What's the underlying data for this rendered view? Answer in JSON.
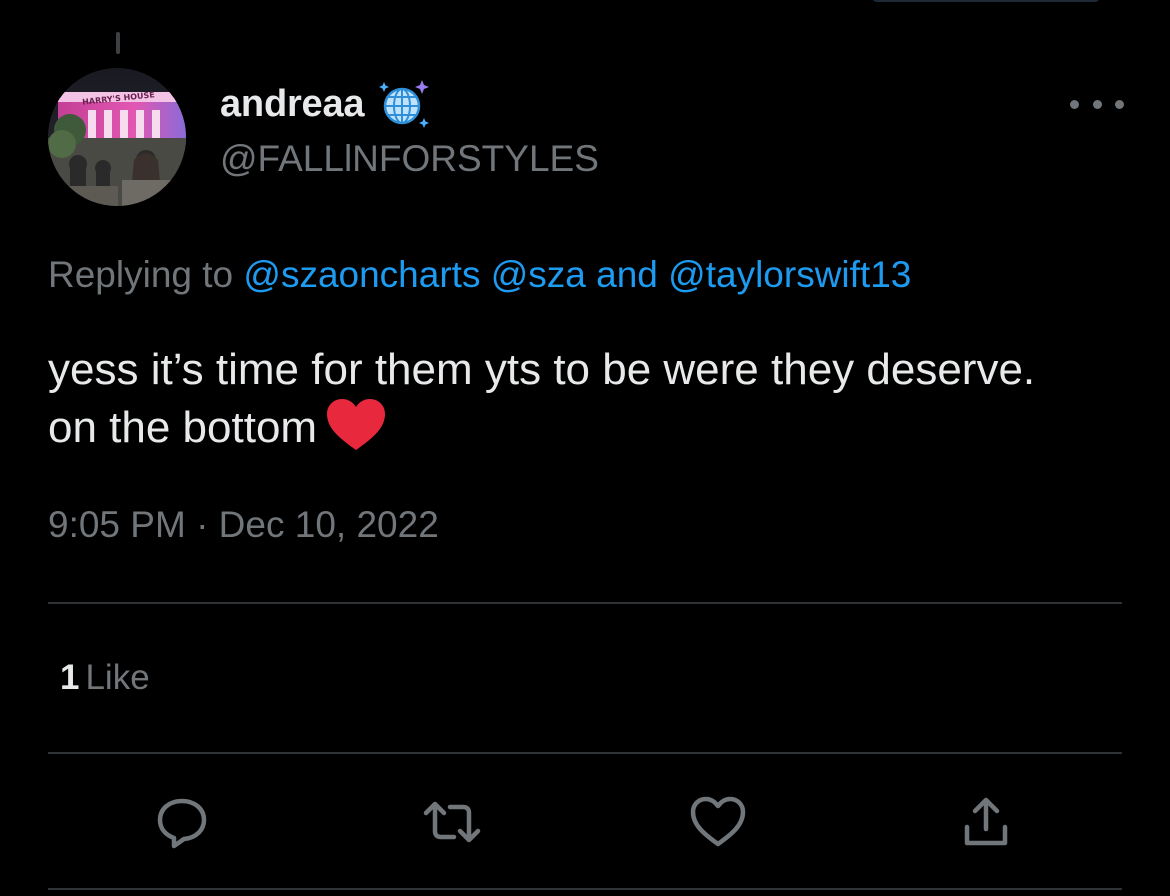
{
  "tweet": {
    "display_name": "andreaa",
    "display_name_emoji": "mirror-ball-icon",
    "handle": "@FALLlNFORSTYLES",
    "replying_prefix": "Replying to",
    "mentions": [
      "@szaoncharts",
      "@sza",
      "@taylorswift13"
    ],
    "replying_joiner": "and",
    "text": "yess it’s time for them yts to be were they deserve. on the bottom",
    "text_emoji": "red-heart-icon",
    "timestamp": "9:05 PM · Dec 10, 2022",
    "likes_count": "1",
    "likes_label": "Like",
    "avatar_sign_text": "HARRY'S HOUSE"
  },
  "actions": [
    {
      "name": "reply",
      "icon": "reply-icon"
    },
    {
      "name": "retweet",
      "icon": "retweet-icon"
    },
    {
      "name": "like",
      "icon": "heart-outline-icon"
    },
    {
      "name": "share",
      "icon": "share-icon"
    }
  ],
  "colors": {
    "background": "#000000",
    "primary_text": "#e7e9ea",
    "secondary_text": "#71767b",
    "link": "#1d9bf0",
    "divider": "#2f3336",
    "heart_emoji": "#e8283c"
  }
}
